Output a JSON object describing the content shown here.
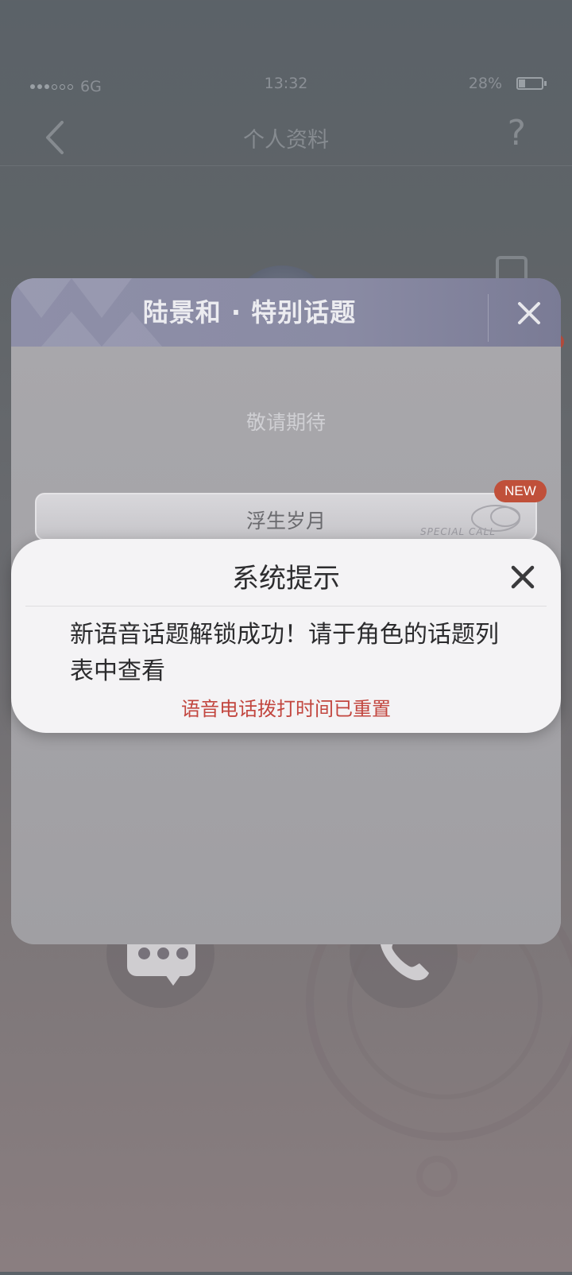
{
  "status_bar": {
    "network": "6G",
    "time": "13:32",
    "battery": "28%",
    "battery_level": 0.28
  },
  "header": {
    "title": "个人资料",
    "help_glyph": "?"
  },
  "topic_panel": {
    "title": "陆景和 · 特别话题",
    "coming_soon": "敬请期待",
    "topic_item": {
      "label": "浮生岁月",
      "watermark": "SPECIAL CALL",
      "badge": "NEW"
    }
  },
  "dialog": {
    "title": "系统提示",
    "message": "新语音话题解锁成功！请于角色的话题列表中查看",
    "sub_message": "语音电话拨打时间已重置"
  },
  "colors": {
    "accent_red": "#c2463f",
    "badge": "#c0503a"
  },
  "icons": {
    "back": "back-arrow-icon",
    "help": "help-icon",
    "close": "close-icon",
    "chat": "chat-icon",
    "phone": "phone-icon"
  }
}
